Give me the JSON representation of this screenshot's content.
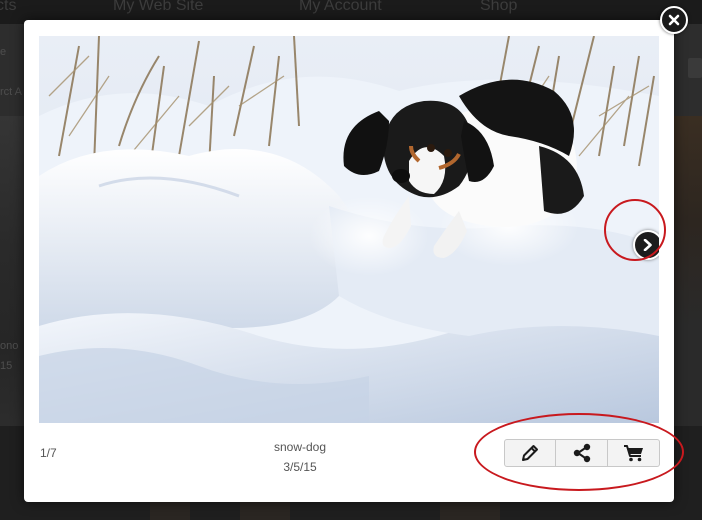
{
  "background_nav": {
    "items": [
      "cts",
      "My Web Site",
      "My Account",
      "Shop"
    ]
  },
  "background_left": {
    "texts": [
      "e",
      "rct A",
      "ono",
      "15"
    ]
  },
  "lightbox": {
    "counter": "1/7",
    "caption": {
      "title": "snow-dog",
      "date": "3/5/15"
    },
    "photo_alt": "snow-dog",
    "actions": [
      {
        "name": "edit-button",
        "icon": "pencil-icon"
      },
      {
        "name": "share-button",
        "icon": "share-icon"
      },
      {
        "name": "cart-button",
        "icon": "cart-icon"
      }
    ],
    "next_icon": "chevron-right-icon",
    "close_icon": "close-icon"
  },
  "colors": {
    "annotation": "#c8191e",
    "overlay": "#2a2a2a",
    "button_bg": "#f3f3f3",
    "icon": "#1a1a1a"
  }
}
